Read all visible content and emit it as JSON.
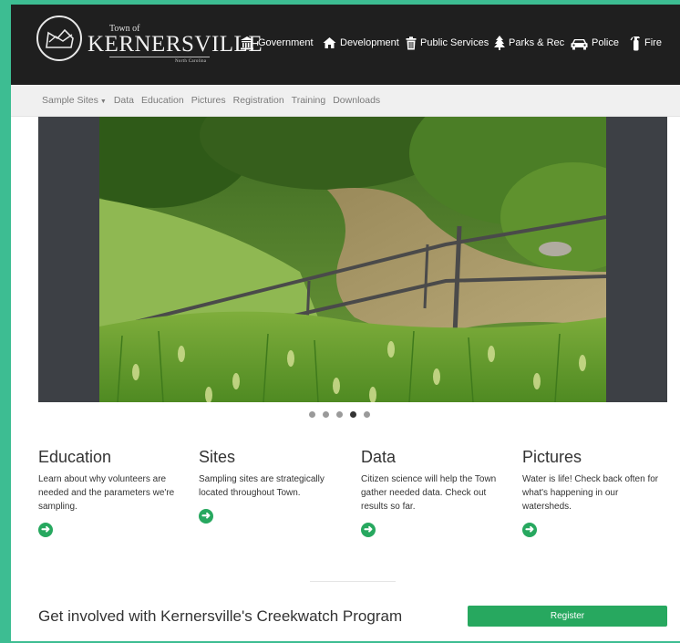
{
  "header": {
    "logo": {
      "town_of": "Town of",
      "name": "Kernersville",
      "state": "North Carolina"
    },
    "nav": [
      {
        "label": "Government",
        "icon": "government-building-icon"
      },
      {
        "label": "Development",
        "icon": "home-icon"
      },
      {
        "label": "Public Services",
        "icon": "trash-can-icon"
      },
      {
        "label": "Parks & Rec",
        "icon": "tree-icon"
      },
      {
        "label": "Police",
        "icon": "police-car-icon"
      },
      {
        "label": "Fire",
        "icon": "fire-extinguisher-icon"
      }
    ]
  },
  "subnav": {
    "items": [
      "Sample Sites",
      "Data",
      "Education",
      "Pictures",
      "Registration",
      "Training",
      "Downloads"
    ]
  },
  "carousel": {
    "slide_count": 5,
    "active_index": 3
  },
  "features": [
    {
      "title": "Education",
      "text": "Learn about why volunteers are needed and the parameters we're sampling.",
      "icon": "arrow-circle-right-icon"
    },
    {
      "title": "Sites",
      "text": "Sampling sites are strategically located throughout Town.",
      "icon": "arrow-circle-right-icon"
    },
    {
      "title": "Data",
      "text": "Citizen science will help the Town gather needed data. Check out results so far.",
      "icon": "arrow-circle-right-icon"
    },
    {
      "title": "Pictures",
      "text": "Water is life! Check back often for what's happening in our watersheds.",
      "icon": "arrow-circle-right-icon"
    }
  ],
  "cta": {
    "text": "Get involved with Kernersville's Creekwatch Program",
    "button_label": "Register"
  },
  "colors": {
    "accent": "#27a85f",
    "page_background": "#3dbd92",
    "header": "#1f1f1f"
  }
}
